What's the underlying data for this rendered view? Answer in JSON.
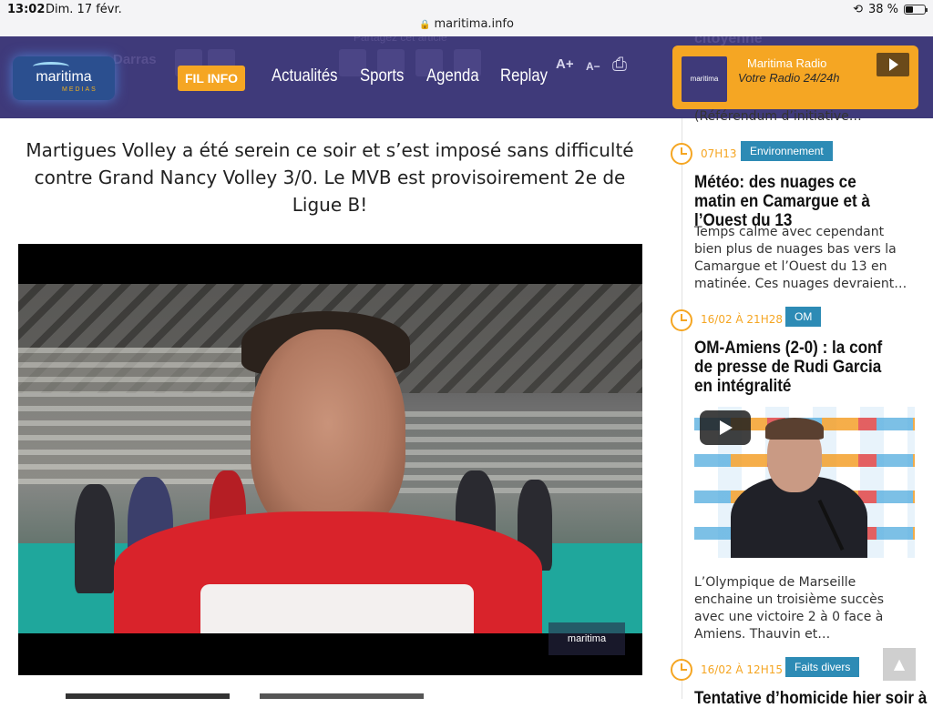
{
  "status_bar": {
    "time": "13:02",
    "date": "Dim. 17 févr.",
    "url": "maritima.info",
    "battery": "38 %",
    "battery_level": 0.38
  },
  "header": {
    "ghost_author": "Darras",
    "ghost_share": "Partagez cet article",
    "ghost_right_title": "citoyenne",
    "logo_text": "maritima",
    "logo_sub": "MEDIAS",
    "fil_info": "FIL INFO",
    "nav": [
      "Actualités",
      "Sports",
      "Agenda",
      "Replay"
    ],
    "font_up": "A+",
    "font_down": "A−",
    "print_icon": "printer-icon",
    "radio": {
      "logo_text": "maritima",
      "name": "Maritima Radio",
      "slogan": "Votre Radio 24/24h"
    }
  },
  "article": {
    "lead": "Martigues Volley a été serein ce soir et s’est imposé sans difficulté contre Grand Nancy Volley 3/0. Le MVB est provisoirement 2e de Ligue B!",
    "video_watermark": "maritima"
  },
  "sidebar": {
    "prev_snippet": "(Référendum d’initiative…",
    "items": [
      {
        "time": "07H13",
        "tag": "Environnement",
        "title": "Météo: des nuages ce matin en Camargue et à l’Ouest du 13",
        "excerpt": "Temps calme avec cependant bien plus de nuages bas vers la Camargue et l’Ouest du 13 en matinée. Ces nuages devraient…"
      },
      {
        "time": "16/02 À 21H28",
        "tag": "OM",
        "title": "OM-Amiens (2-0) : la conf de presse de Rudi Garcia en intégralité",
        "excerpt": "L’Olympique de Marseille enchaine un troisième succès avec une victoire 2 à 0 face à Amiens. Thauvin et…"
      },
      {
        "time": "16/02 À 12H15",
        "tag": "Faits divers",
        "title": "Tentative d’homicide hier soir à"
      }
    ],
    "scroll_top": "▲"
  },
  "colors": {
    "header_bg": "#3f3a7a",
    "accent": "#f5a623",
    "tag_bg": "#2d8bb5"
  }
}
